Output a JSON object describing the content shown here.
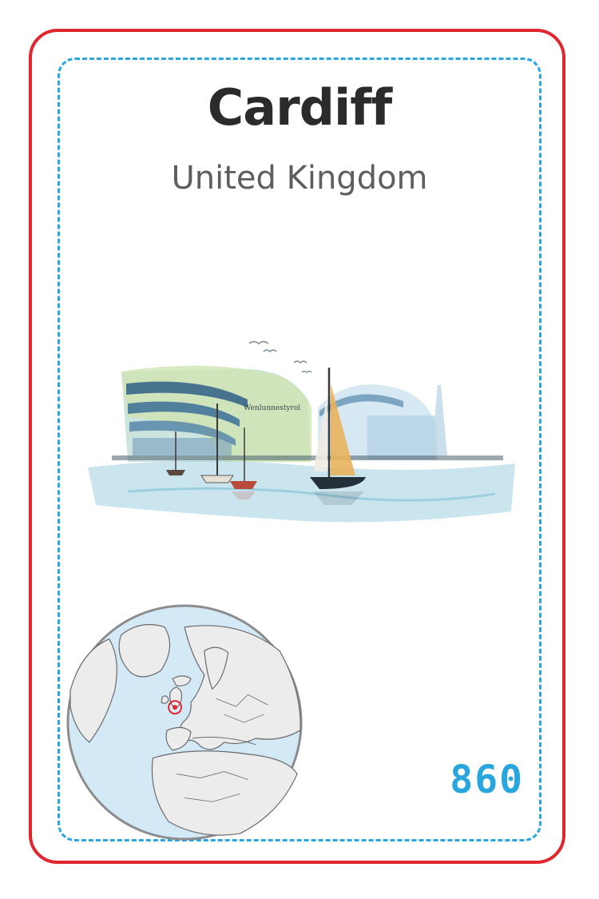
{
  "card": {
    "city": "Cardiff",
    "country": "United Kingdom",
    "number": "860"
  },
  "colors": {
    "border": "#e0262e",
    "dashed_border": "#2aa6df",
    "number": "#2aa6df",
    "ocean": "#d3e9f6",
    "land": "#ececec",
    "marker": "#e0262e"
  },
  "icons": {
    "illustration": "cardiff-bay-watercolor",
    "globe": "globe-europe-locator"
  }
}
